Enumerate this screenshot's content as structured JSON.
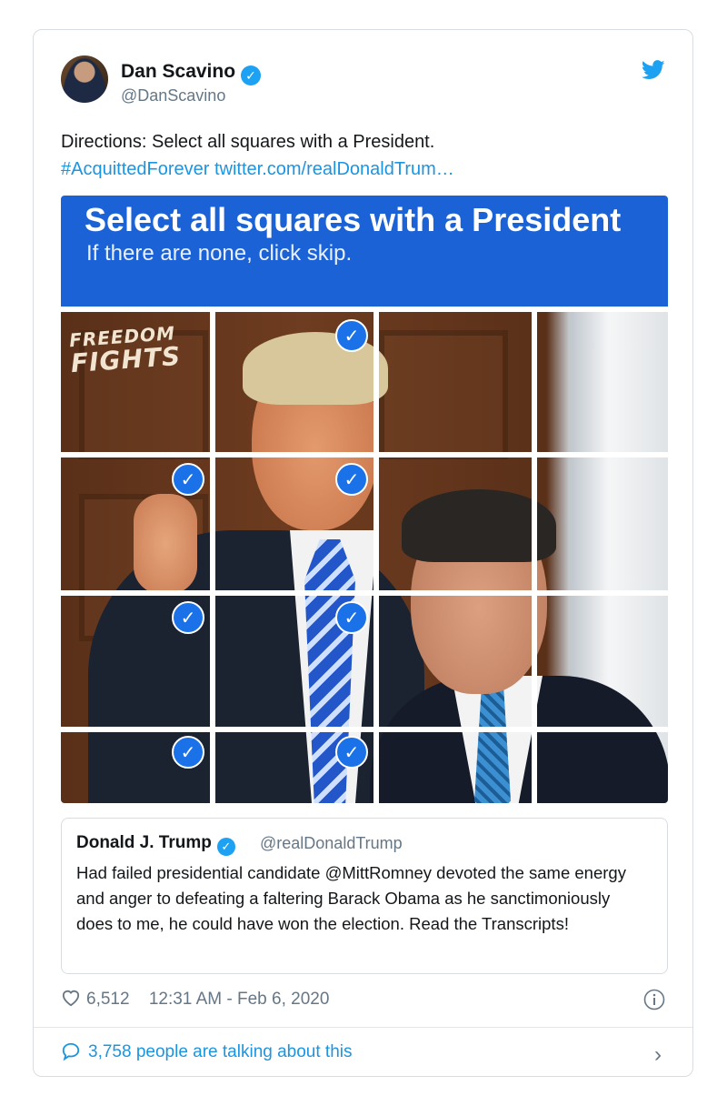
{
  "author": {
    "name": "Dan Scavino",
    "handle": "@DanScavino",
    "verified_mark": "✓"
  },
  "tweet": {
    "text": "Directions: Select all squares with a President.",
    "hashtag": "#AcquittedForever",
    "link": "twitter.com/realDonaldTrum…"
  },
  "media": {
    "banner_title": "Select all squares with a President",
    "banner_subtitle": "If there are none, click skip.",
    "logo_line1": "FREEDOM",
    "logo_line2": "FIGHTS",
    "check_mark": "✓"
  },
  "quoted_tweet": {
    "name": "Donald J. Trump",
    "handle": "@realDonaldTrump",
    "text": "Had failed presidential candidate @MittRomney devoted the same energy and anger to defeating a faltering Barack Obama as he sanctimoniously does to me, he could have won the election. Read the Transcripts!"
  },
  "footer": {
    "likes": "6,512",
    "timestamp": "12:31 AM - Feb 6, 2020",
    "talking": "3,758 people are talking about this",
    "chevron": "›"
  },
  "colors": {
    "accent": "#1da1f2",
    "link": "#1b95e0",
    "banner": "#1b62d6",
    "check": "#1b72e8",
    "muted": "#657786"
  },
  "icons": [
    "twitter-bird-icon",
    "verified-icon",
    "heart-icon",
    "info-icon",
    "reply-bubble-icon",
    "chevron-right-icon",
    "checkmark-icon"
  ]
}
